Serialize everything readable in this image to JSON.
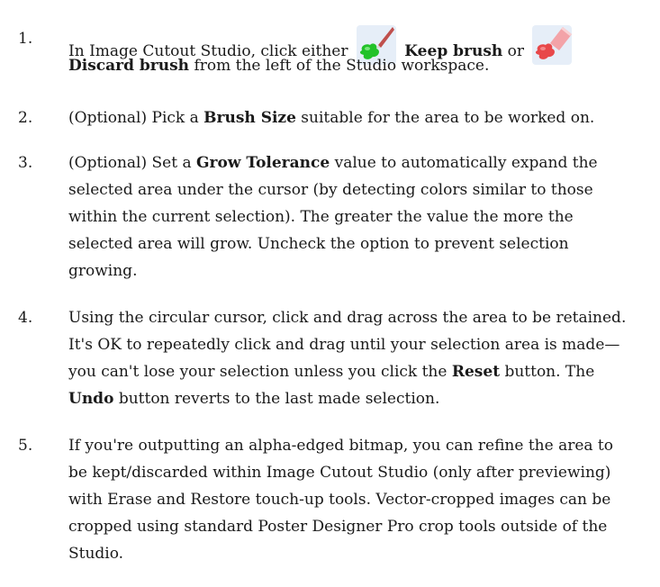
{
  "steps": [
    {
      "number": "1.",
      "line1_a": "In Image Cutout Studio, click either",
      "keep_icon": "keep-brush-icon",
      "line1_b": "Keep brush",
      "line1_c": " or",
      "discard_icon": "discard-brush-icon",
      "line2_a": "Discard brush",
      "line2_b": " from the left of the Studio workspace."
    },
    {
      "number": "2.",
      "line1_a": "(Optional) Pick a ",
      "line1_b": "Brush Size",
      "line1_c": " suitable for the area to be worked on."
    },
    {
      "number": "3.",
      "line1_a": "(Optional) Set a ",
      "line1_b": "Grow Tolerance",
      "line1_c": " value to automatically expand the",
      "line2": "selected area under the cursor (by detecting colors similar to those",
      "line3": "within the current selection). The greater the value the more the",
      "line4": "selected area will grow. Uncheck the option to prevent selection",
      "line5": "growing."
    },
    {
      "number": "4.",
      "line1": "Using the circular cursor, click and drag across the area to be retained.",
      "line2": "It's OK to repeatedly click and drag until your selection area is made—",
      "line3_a": "you can't lose your selection unless you click the ",
      "line3_b": "Reset",
      "line3_c": " button. The",
      "line4_a": "Undo",
      "line4_b": " button reverts to the last made selection."
    },
    {
      "number": "5.",
      "line1": "If you're outputting an alpha-edged bitmap, you can refine the area to",
      "line2": "be kept/discarded within Image Cutout Studio (only after previewing)",
      "line3": "with Erase and Restore touch-up tools. Vector-cropped images can be",
      "line4": "cropped using standard Poster Designer Pro crop tools outside of the",
      "line5": "Studio."
    }
  ],
  "colors": {
    "text": "#1a1a1a",
    "keep_brush_green": "#22c229",
    "discard_brush_red": "#e8484a",
    "icon_background": "#e6eef8"
  }
}
